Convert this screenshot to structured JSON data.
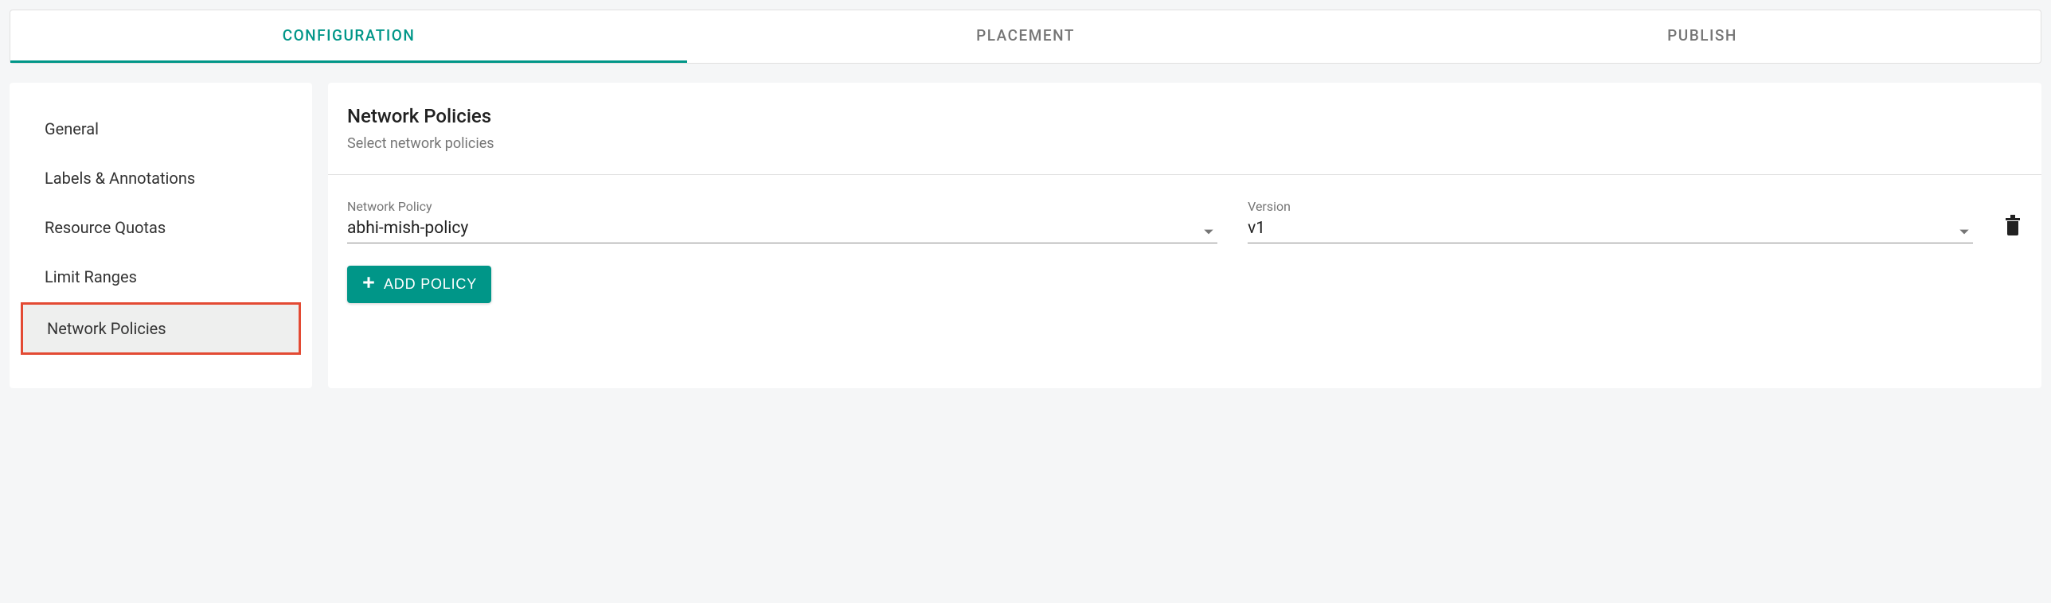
{
  "tabs": {
    "configuration": "CONFIGURATION",
    "placement": "PLACEMENT",
    "publish": "PUBLISH"
  },
  "sidebar": {
    "items": [
      {
        "label": "General"
      },
      {
        "label": "Labels & Annotations"
      },
      {
        "label": "Resource Quotas"
      },
      {
        "label": "Limit Ranges"
      },
      {
        "label": "Network Policies"
      }
    ]
  },
  "panel": {
    "title": "Network Policies",
    "subtitle": "Select network policies",
    "policy_field_label": "Network Policy",
    "version_field_label": "Version",
    "add_button_label": "ADD POLICY"
  },
  "form": {
    "policy_value": "abhi-mish-policy",
    "version_value": "v1"
  }
}
